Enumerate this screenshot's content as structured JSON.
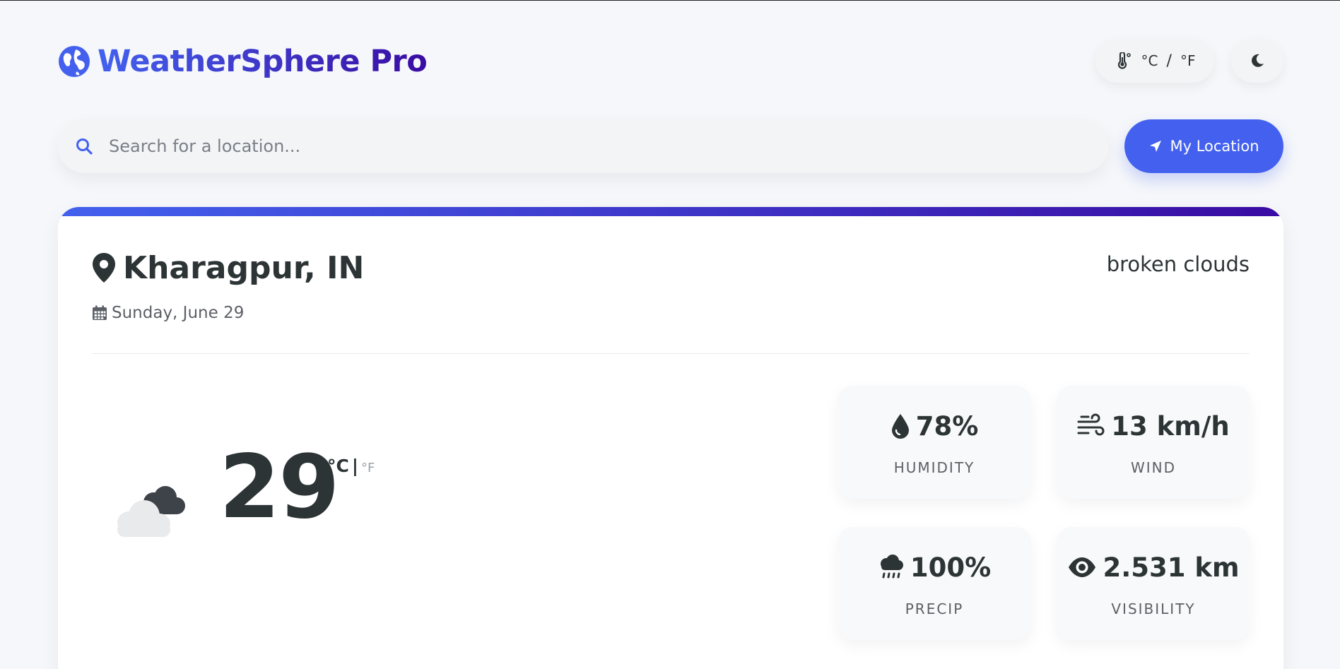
{
  "app": {
    "title": "WeatherSphere Pro",
    "brand_gradient": [
      "#4361ee",
      "#3a0ca3"
    ],
    "logo_icon": "globe-icon"
  },
  "header": {
    "unit_toggle": {
      "icon": "thermometer-icon",
      "celsius": "°C",
      "separator": "/",
      "fahrenheit": "°F"
    },
    "theme_toggle": {
      "icon": "moon-icon"
    }
  },
  "search": {
    "icon": "search-icon",
    "placeholder": "Search for a location...",
    "value": ""
  },
  "location_button": {
    "icon": "location-arrow-icon",
    "label": "My Location",
    "color": "#4361ee"
  },
  "current": {
    "city": "Kharagpur, IN",
    "date": "Sunday, June 29",
    "condition": "broken clouds",
    "weather_icon": "broken-clouds-icon",
    "temperature": "29",
    "unit_active": "°C",
    "unit_separator": "|",
    "unit_inactive": "°F"
  },
  "stats": [
    {
      "icon": "droplet-icon",
      "value": "78%",
      "label": "HUMIDITY"
    },
    {
      "icon": "wind-icon",
      "value": "13 km/h",
      "label": "WIND"
    },
    {
      "icon": "rain-cloud-icon",
      "value": "100%",
      "label": "PRECIP"
    },
    {
      "icon": "eye-icon",
      "value": "2.531 km",
      "label": "VISIBILITY"
    }
  ]
}
